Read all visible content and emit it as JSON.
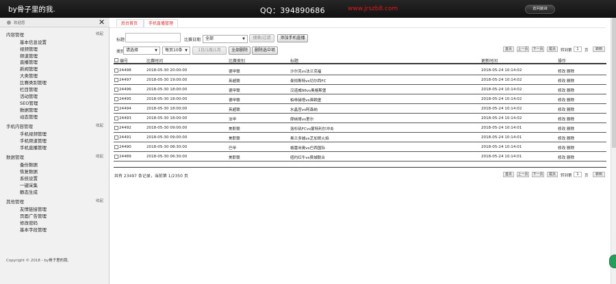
{
  "header": {
    "brand": "by骨子里的我.",
    "qq": "QQ：394890686",
    "site": "www.jrszb8.com",
    "visit_button": "访问前台"
  },
  "sidebar": {
    "user": "欢迎您",
    "close": "✕",
    "groups": [
      {
        "title": "内容管理",
        "toggle": "收起",
        "items": [
          "基本信息设置",
          "视频管理",
          "频道管理",
          "直播管理",
          "新闻管理",
          "大类管理",
          "比赛类别管理",
          "栏目管理",
          "活动管理",
          "SEO管理",
          "数据管理",
          "动态管理"
        ]
      },
      {
        "title": "手机内容管理",
        "toggle": "收起",
        "items": [
          "手机视频管理",
          "手机频道管理",
          "手机直播管理"
        ]
      },
      {
        "title": "数据管理",
        "toggle": "收起",
        "items": [
          "备份数据",
          "恢复数据",
          "系统设置",
          "一键采集",
          "静态生成"
        ]
      },
      {
        "title": "其他管理",
        "toggle": "收起",
        "items": [
          "友情链接管理",
          "页面广告管理",
          "修改密码",
          "基本字段管理"
        ]
      }
    ],
    "copyright": "Copyright © 2018 - by",
    "copyright_owner": "骨子里的我."
  },
  "main": {
    "tabs": [
      "后台首页",
      "手机直播管理"
    ],
    "filters": {
      "title_label": "标题",
      "title_value": "",
      "date_label": "比赛日期",
      "date_value": "全部",
      "filter_button": "搜索/过滤",
      "add_button": "添加手机直播",
      "category_label": "类别",
      "category_value": "请选择",
      "pagesize_value": "每页10条",
      "batch_buttons": [
        "1日/1周/1月",
        "全部删除",
        "删除选中项"
      ]
    },
    "pager": {
      "first": "首页",
      "prev": "上一页",
      "next": "下一页",
      "last": "尾页",
      "goto_label": "转到第",
      "page_value": "1",
      "page_unit": "页",
      "go": "转到"
    },
    "columns": [
      "编号",
      "比赛时间",
      "比赛类别",
      "标题",
      "更新时间",
      "操作"
    ],
    "rows": [
      {
        "id": "24498",
        "time": "2018-05-30 20:00:00",
        "cat": "德甲联",
        "title": "沙尔克vs法兰克福",
        "updated": "2018-05-24 10:14:02",
        "edit": "修改",
        "del": "删除"
      },
      {
        "id": "24497",
        "time": "2018-05-30 19:00:00",
        "cat": "英超联",
        "title": "曼彻斯特vs切尔西FC",
        "updated": "2018-05-24 10:14:02",
        "edit": "修改",
        "del": "删除"
      },
      {
        "id": "24496",
        "time": "2018-05-30 18:00:00",
        "cat": "德甲联",
        "title": "汉诺威96vs奥格斯堡",
        "updated": "2018-05-24 10:14:02",
        "edit": "修改",
        "del": "删除"
      },
      {
        "id": "24495",
        "time": "2018-05-30 18:00:00",
        "cat": "德甲联",
        "title": "柏林赫塔vs弗赖堡",
        "updated": "2018-05-24 10:14:02",
        "edit": "修改",
        "del": "删除"
      },
      {
        "id": "24494",
        "time": "2018-05-30 18:00:00",
        "cat": "英超联",
        "title": "水晶宫vs阿森纳",
        "updated": "2018-05-24 10:14:02",
        "edit": "修改",
        "del": "删除"
      },
      {
        "id": "24493",
        "time": "2018-05-30 18:00:00",
        "cat": "法甲",
        "title": "摩纳哥vs里尔",
        "updated": "2018-05-24 10:14:02",
        "edit": "修改",
        "del": "删除"
      },
      {
        "id": "24492",
        "time": "2018-05-30 09:00:00",
        "cat": "美职联",
        "title": "洛杉矶FCvs蒙特利尔冲击",
        "updated": "2018-05-24 10:14:01",
        "edit": "修改",
        "del": "删除"
      },
      {
        "id": "24491",
        "time": "2018-05-30 09:00:00",
        "cat": "美职联",
        "title": "奥兰多城vs芝加哥火焰",
        "updated": "2018-05-24 10:14:01",
        "edit": "修改",
        "del": "删除"
      },
      {
        "id": "24490",
        "time": "2018-05-30 08:30:00",
        "cat": "巴甲",
        "title": "格雷米奥vs巴西国际",
        "updated": "2018-05-24 10:14:01",
        "edit": "修改",
        "del": "删除"
      },
      {
        "id": "24489",
        "time": "2018-05-30 06:30:00",
        "cat": "美职联",
        "title": "纽约红牛vs费城联合",
        "updated": "2018-05-24 10:14:01",
        "edit": "修改",
        "del": "删除"
      }
    ],
    "total": "共有 23497 条记录，当前第 1/2350 页"
  }
}
